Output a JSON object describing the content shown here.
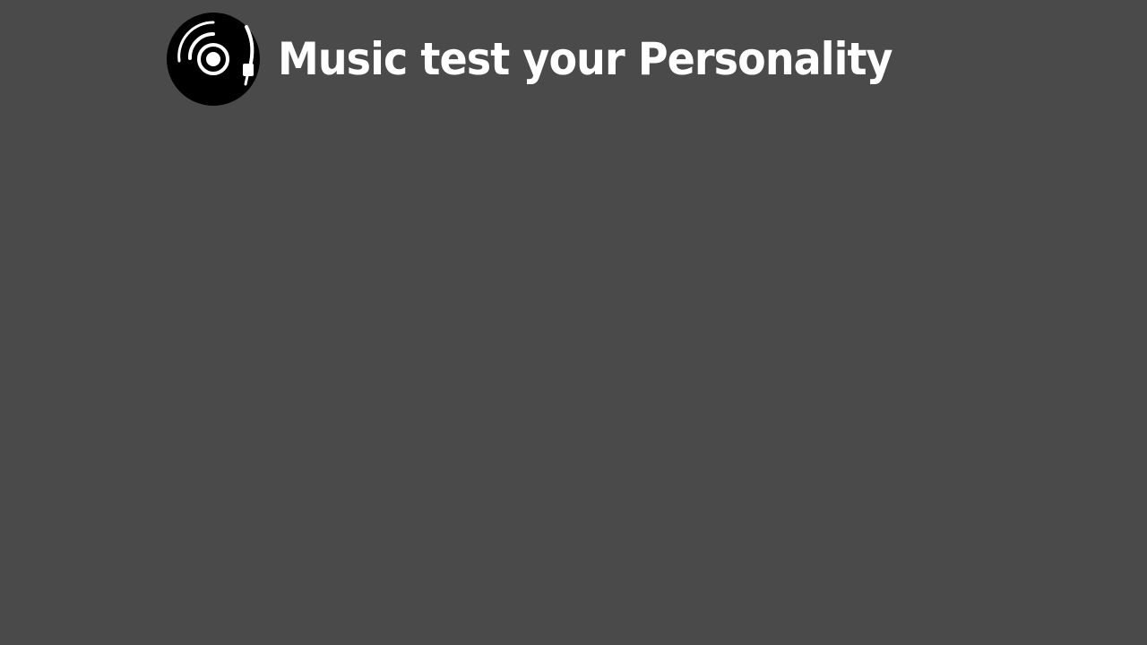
{
  "app": {
    "title": "Music test your Personality",
    "logo_icon": "vinyl-record-icon"
  },
  "colors": {
    "background": "#4a4a4a",
    "title": "#ffffff",
    "logo_disc": "#000000",
    "logo_marks": "#ffffff"
  }
}
